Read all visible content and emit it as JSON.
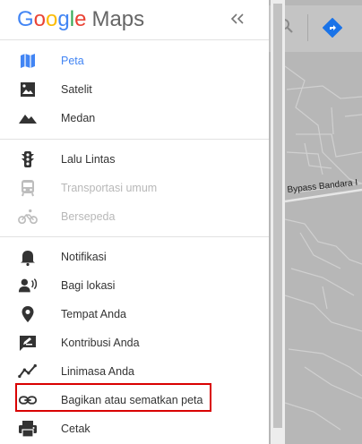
{
  "header": {
    "logo_word": "Google",
    "logo_product": "Maps"
  },
  "section_layers": [
    {
      "label": "Peta",
      "icon": "map-icon",
      "state": "active"
    },
    {
      "label": "Satelit",
      "icon": "satellite-icon",
      "state": "normal"
    },
    {
      "label": "Medan",
      "icon": "terrain-icon",
      "state": "normal"
    }
  ],
  "section_overlays": [
    {
      "label": "Lalu Lintas",
      "icon": "traffic-icon",
      "state": "normal"
    },
    {
      "label": "Transportasi umum",
      "icon": "transit-icon",
      "state": "disabled"
    },
    {
      "label": "Bersepeda",
      "icon": "bike-icon",
      "state": "disabled"
    }
  ],
  "section_actions": [
    {
      "label": "Notifikasi",
      "icon": "bell-icon"
    },
    {
      "label": "Bagi lokasi",
      "icon": "share-location-icon"
    },
    {
      "label": "Tempat Anda",
      "icon": "place-pin-icon"
    },
    {
      "label": "Kontribusi Anda",
      "icon": "edit-icon"
    },
    {
      "label": "Linimasa Anda",
      "icon": "timeline-icon"
    },
    {
      "label": "Bagikan atau sematkan peta",
      "icon": "link-icon"
    },
    {
      "label": "Cetak",
      "icon": "print-icon"
    }
  ],
  "map": {
    "road_label": "Bypass Bandara I"
  },
  "colors": {
    "accent": "#4285f4",
    "highlight": "#d90000",
    "direction_button": "#1a73e8"
  }
}
